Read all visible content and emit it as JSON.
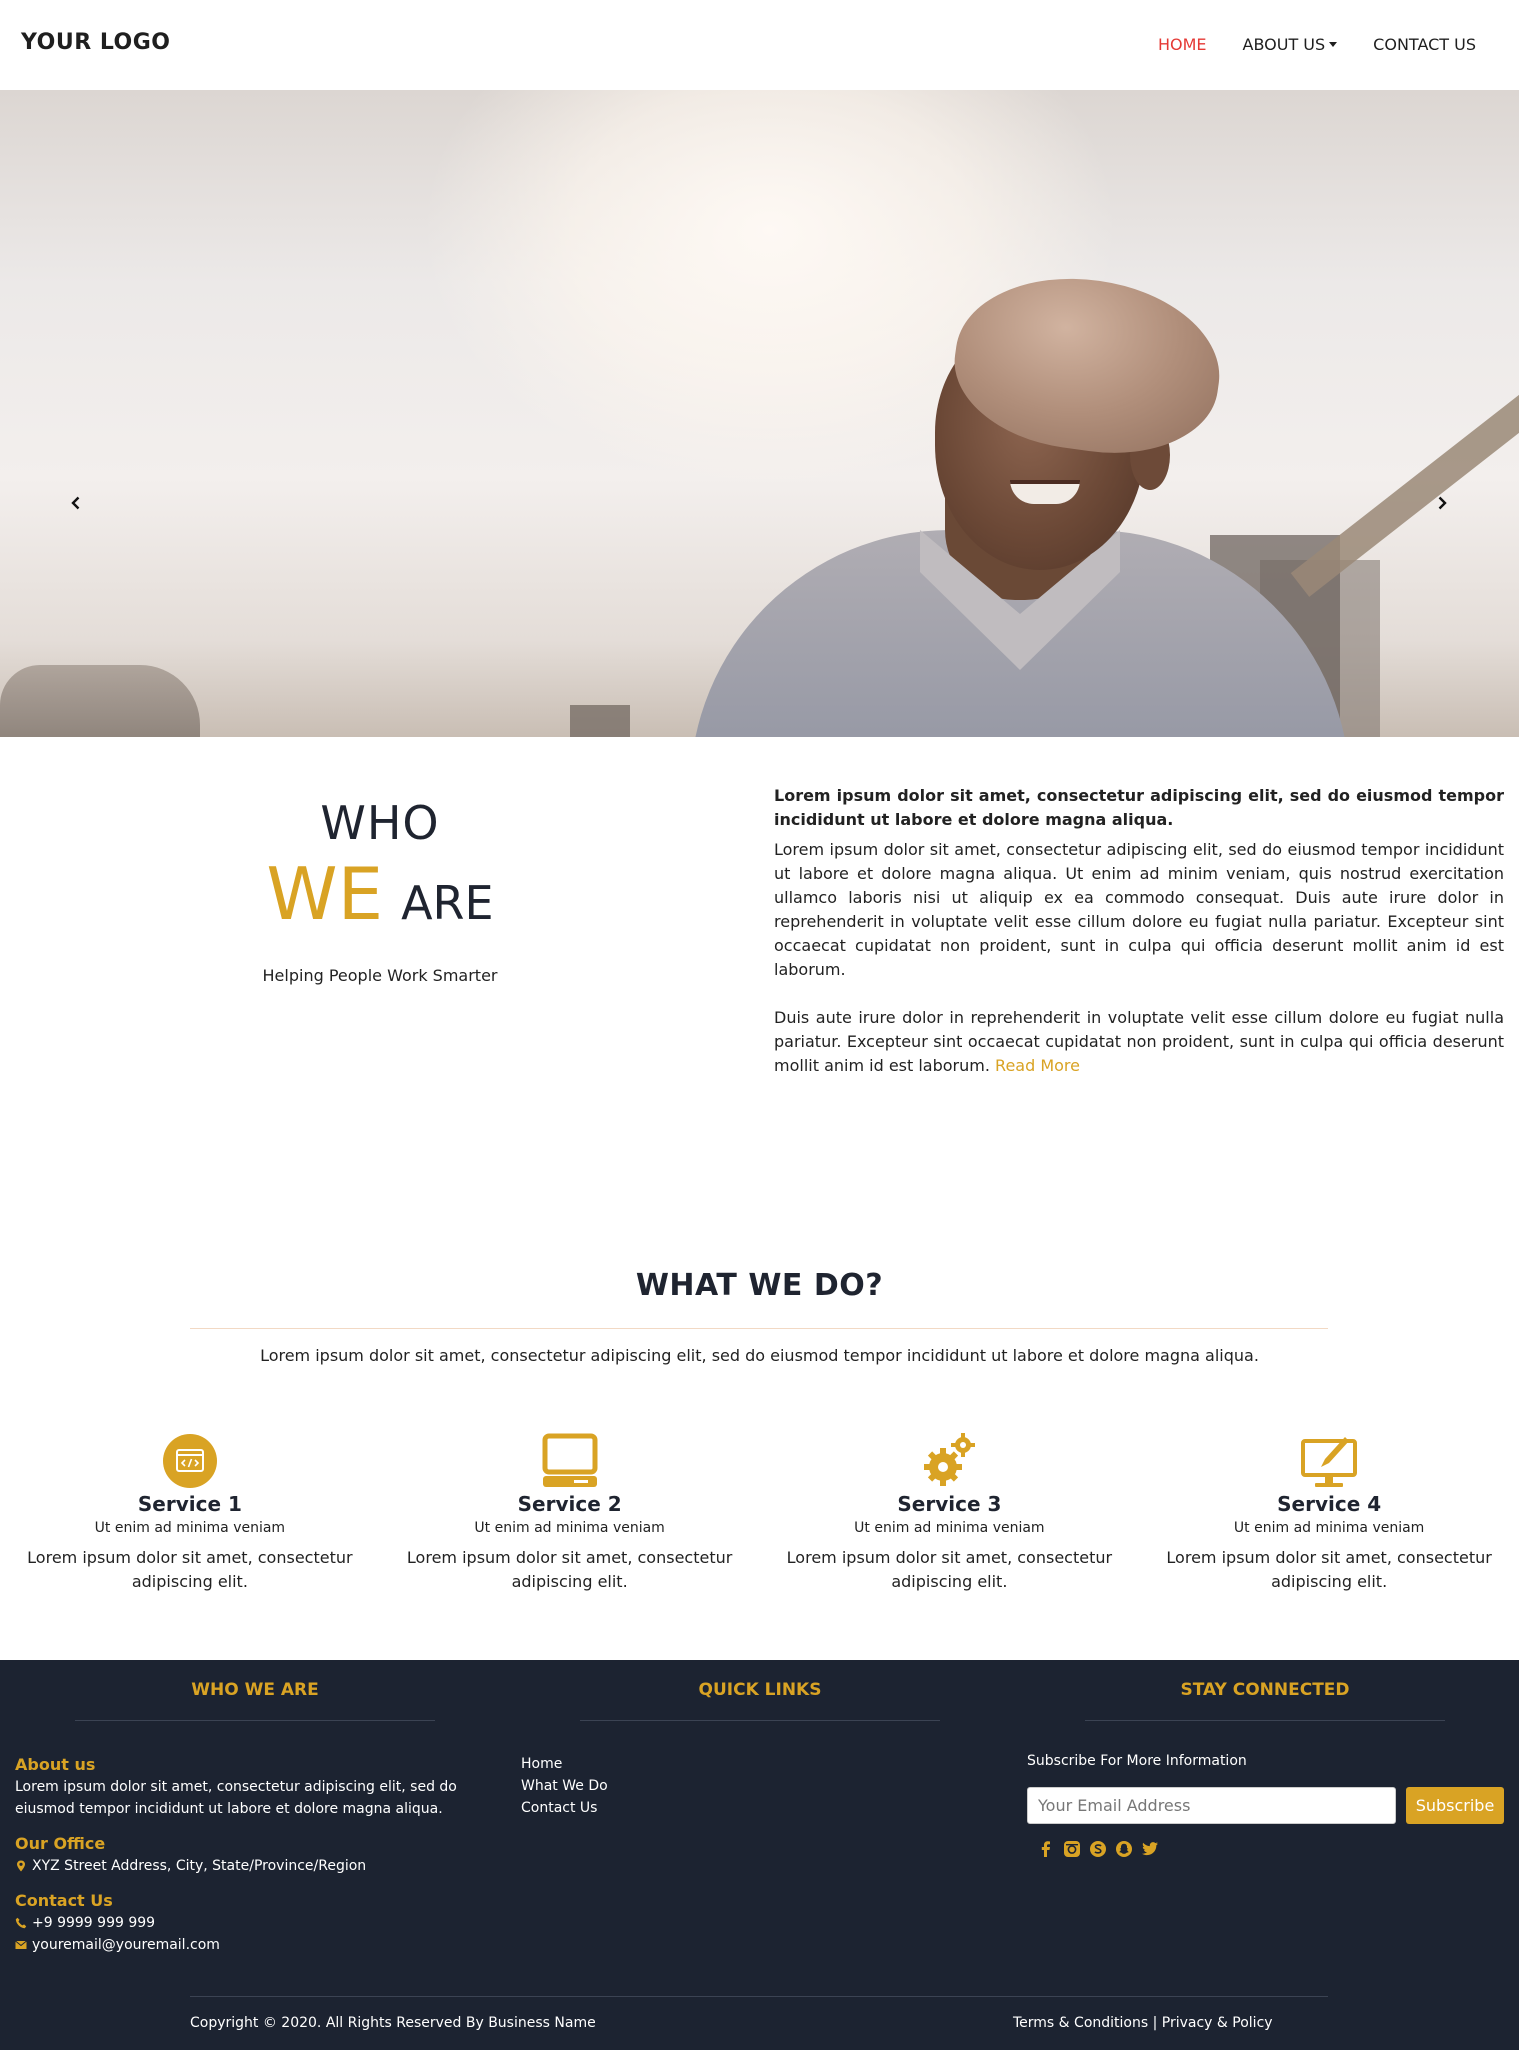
{
  "header": {
    "logo": "YOUR LOGO",
    "nav": [
      {
        "label": "HOME"
      },
      {
        "label": "ABOUT US"
      },
      {
        "label": "CONTACT US"
      }
    ]
  },
  "hero": {
    "prev_icon": "chevron-left-icon",
    "next_icon": "chevron-right-icon"
  },
  "who": {
    "title_line1": "WHO",
    "title_we": "WE",
    "title_are": "ARE",
    "subtitle": "Helping People Work Smarter",
    "lead": "Lorem ipsum dolor sit amet, consectetur adipiscing elit, sed do eiusmod tempor incididunt ut labore et dolore magna aliqua.",
    "para1": "Lorem ipsum dolor sit amet, consectetur adipiscing elit, sed do eiusmod tempor incididunt ut labore et dolore magna aliqua. Ut enim ad minim veniam, quis nostrud exercitation ullamco laboris nisi ut aliquip ex ea commodo consequat. Duis aute irure dolor in reprehenderit in voluptate velit esse cillum dolore eu fugiat nulla pariatur. Excepteur sint occaecat cupidatat non proident, sunt in culpa qui officia deserunt mollit anim id est laborum.",
    "para2": "Duis aute irure dolor in reprehenderit in voluptate velit esse cillum dolore eu fugiat nulla pariatur. Excepteur sint occaecat cupidatat non proident, sunt in culpa qui officia deserunt mollit anim id est laborum.",
    "read_more": "Read More"
  },
  "what_we_do": {
    "title": "WHAT WE DO?",
    "subtitle": "Lorem ipsum dolor sit amet, consectetur adipiscing elit, sed do eiusmod tempor incididunt ut labore et dolore magna aliqua.",
    "services": [
      {
        "icon": "code-window-icon",
        "title": "Service 1",
        "sub": "Ut enim ad minima veniam",
        "desc": "Lorem ipsum dolor sit amet, consectetur adipiscing elit."
      },
      {
        "icon": "laptop-icon",
        "title": "Service 2",
        "sub": "Ut enim ad minima veniam",
        "desc": "Lorem ipsum dolor sit amet, consectetur adipiscing elit."
      },
      {
        "icon": "gears-icon",
        "title": "Service 3",
        "sub": "Ut enim ad minima veniam",
        "desc": "Lorem ipsum dolor sit amet, consectetur adipiscing elit."
      },
      {
        "icon": "monitor-pen-icon",
        "title": "Service 4",
        "sub": "Ut enim ad minima veniam",
        "desc": "Lorem ipsum dolor sit amet, consectetur adipiscing elit."
      }
    ]
  },
  "footer": {
    "col1_title": "WHO WE ARE",
    "col2_title": "QUICK LINKS",
    "col3_title": "STAY CONNECTED",
    "about_label": "About us",
    "about_text": "Lorem ipsum dolor sit amet, consectetur adipiscing elit, sed do eiusmod tempor incididunt ut labore et dolore magna aliqua.",
    "office_label": "Our Office",
    "office_address": "XYZ Street Address, City, State/Province/Region",
    "contact_label": "Contact Us",
    "phone": "+9 9999 999 999",
    "email": "youremail@youremail.com",
    "links": [
      {
        "label": "Home"
      },
      {
        "label": "What We Do"
      },
      {
        "label": "Contact Us"
      }
    ],
    "subscribe_label": "Subscribe For More Information",
    "email_placeholder": "Your Email Address",
    "subscribe_button": "Subscribe",
    "social_icons": [
      "facebook-icon",
      "instagram-icon",
      "skype-icon",
      "snapchat-icon",
      "twitter-icon"
    ],
    "copyright": "Copyright © 2020. All Rights Reserved By Business Name",
    "terms": "Terms & Conditions",
    "separator": " | ",
    "privacy": "Privacy & Policy"
  },
  "colors": {
    "accent": "#d9a324",
    "nav_active": "#e53935",
    "footer_bg": "#1c2331"
  }
}
